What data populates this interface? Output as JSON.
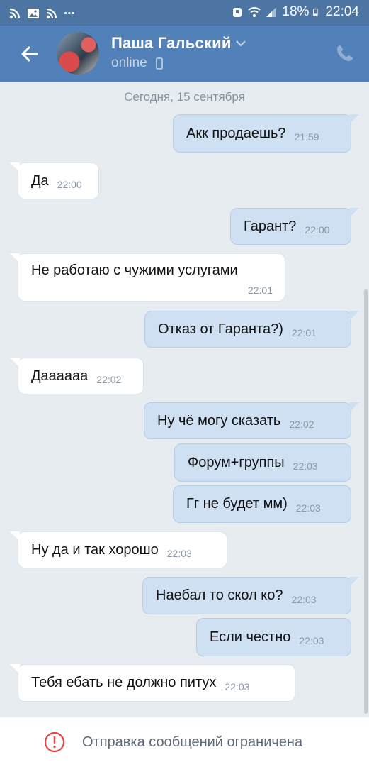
{
  "status_bar": {
    "battery": "18%",
    "time": "22:04",
    "overflow": "..."
  },
  "header": {
    "contact_name": "Паша Гальский",
    "status": "online"
  },
  "chat": {
    "date_separator": "Сегодня, 15 сентября",
    "messages": [
      {
        "direction": "out",
        "text": "Акк продаешь?",
        "time": "21:59"
      },
      {
        "direction": "in",
        "text": "Да",
        "time": "22:00"
      },
      {
        "direction": "out",
        "text": "Гарант?",
        "time": "22:00"
      },
      {
        "direction": "in",
        "text": "Не работаю с чужими услугами",
        "time": "22:01"
      },
      {
        "direction": "out",
        "text": "Отказ от Гаранта?)",
        "time": "22:01"
      },
      {
        "direction": "in",
        "text": "Даааааа",
        "time": "22:02"
      },
      {
        "direction": "out",
        "text": "Ну чё могу сказать",
        "time": "22:02"
      },
      {
        "direction": "out",
        "text": "Форум+группы",
        "time": "22:03"
      },
      {
        "direction": "out",
        "text": "Гг не будет мм)",
        "time": "22:03"
      },
      {
        "direction": "in",
        "text": "Ну да и так хорошо",
        "time": "22:03"
      },
      {
        "direction": "out",
        "text": "Наебал то скол ко?",
        "time": "22:03"
      },
      {
        "direction": "out",
        "text": "Если честно",
        "time": "22:03"
      },
      {
        "direction": "in",
        "text": "Тебя ебать не должно питух",
        "time": "22:03"
      }
    ]
  },
  "footer": {
    "restriction_text": "Отправка сообщений ограничена"
  },
  "colors": {
    "header": "#5181b8",
    "status_bar": "#4c75a3",
    "chat_background": "#e7ecf1",
    "outgoing_bubble": "#cfe0f3",
    "incoming_bubble": "#ffffff",
    "warning": "#e64646"
  },
  "icons": [
    "rss-icon",
    "image-icon",
    "rss-icon",
    "alarm-icon",
    "wifi-icon",
    "signal-icon",
    "battery-icon",
    "back-arrow-icon",
    "chevron-down-icon",
    "mobile-icon",
    "phone-icon",
    "warning-icon"
  ]
}
